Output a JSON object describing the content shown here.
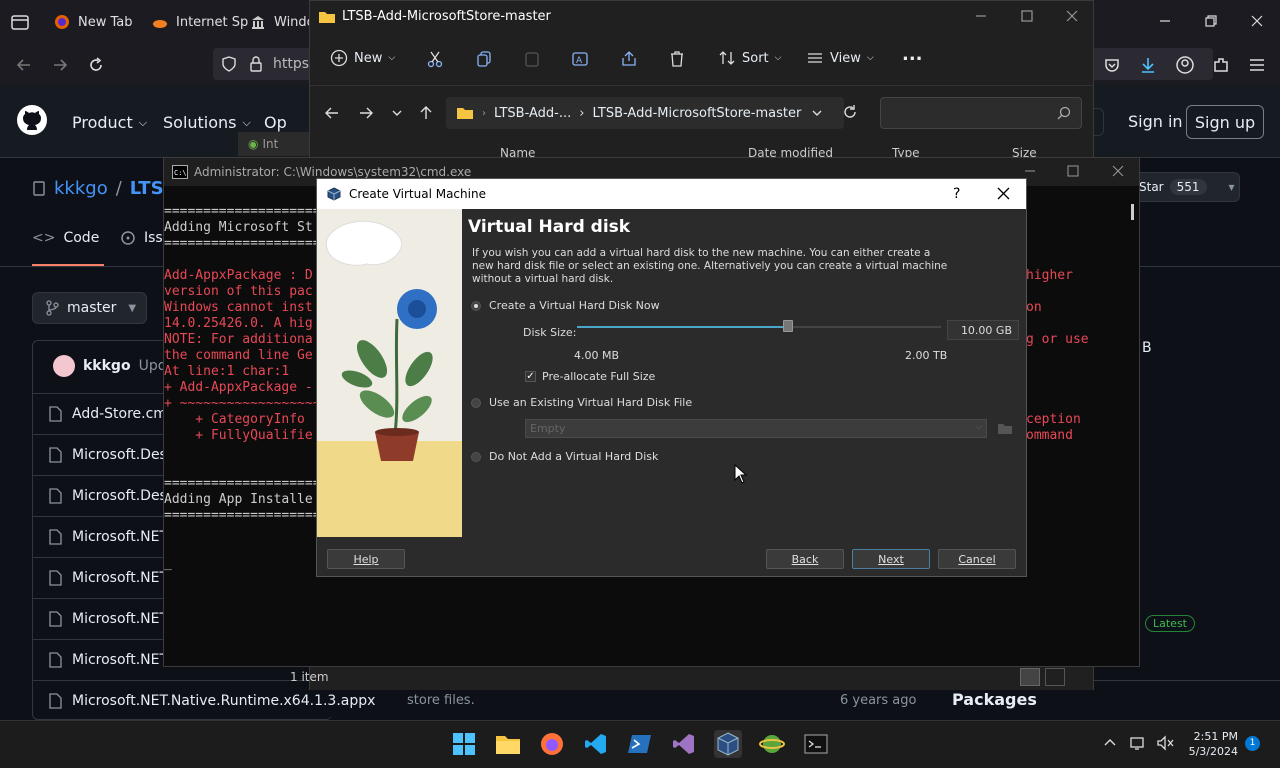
{
  "browser": {
    "tabs": [
      {
        "label": "New Tab"
      },
      {
        "label": "Internet Sp"
      },
      {
        "label": "Window"
      }
    ],
    "url": "https:"
  },
  "github": {
    "nav": [
      "Product",
      "Solutions",
      "Op"
    ],
    "sign_in": "Sign in",
    "sign_up": "Sign up",
    "owner": "kkkgo",
    "repo": "LTSB",
    "tabs": {
      "code": "Code",
      "issues": "Issu"
    },
    "branch": "master",
    "commit_user": "kkkgo",
    "commit_text": "Upda",
    "star_label": "Star",
    "star_count": "551",
    "files": [
      "Add-Store.cmd",
      "Microsoft.Desk",
      "Microsoft.Desk",
      "Microsoft.NET.",
      "Microsoft.NET.",
      "Microsoft.NET.",
      "Microsoft.NET.",
      "Microsoft.NET.Native.Runtime.x64.1.3.appx"
    ],
    "last_row_msg": "store files.",
    "last_row_date": "6 years ago",
    "side_size": "B",
    "latest_badge": "Latest",
    "packages": "Packages",
    "behind_ie_label": "Int"
  },
  "explorer": {
    "title": "LTSB-Add-MicrosoftStore-master",
    "toolbar": {
      "new": "New",
      "sort": "Sort",
      "view": "View",
      "more": "..."
    },
    "breadcrumb": [
      "LTSB-Add-...",
      "LTSB-Add-MicrosoftStore-master"
    ],
    "columns": [
      "Name",
      "Date modified",
      "Type",
      "Size"
    ],
    "status": "1 item"
  },
  "cmd": {
    "title": "Administrator: C:\\Windows\\system32\\cmd.exe",
    "lines_left": [
      {
        "t": "==============================",
        "c": "w"
      },
      {
        "t": "Adding Microsoft St",
        "c": "w"
      },
      {
        "t": "==============================",
        "c": "w"
      },
      {
        "t": "",
        "c": "w"
      },
      {
        "t": "Add-AppxPackage : D",
        "c": "r"
      },
      {
        "t": "version of this pac",
        "c": "r"
      },
      {
        "t": "Windows cannot inst",
        "c": "r"
      },
      {
        "t": "14.0.25426.0. A hig",
        "c": "r"
      },
      {
        "t": "NOTE: For additiona",
        "c": "r"
      },
      {
        "t": "the command line Ge",
        "c": "r"
      },
      {
        "t": "At line:1 char:1",
        "c": "r"
      },
      {
        "t": "+ Add-AppxPackage -",
        "c": "r"
      },
      {
        "t": "+ ~~~~~~~~~~~~~~~~~~",
        "c": "r"
      },
      {
        "t": "    + CategoryInfo",
        "c": "r"
      },
      {
        "t": "    + FullyQualifie",
        "c": "r"
      },
      {
        "t": "",
        "c": "w"
      },
      {
        "t": "",
        "c": "w"
      },
      {
        "t": "==============================",
        "c": "w"
      },
      {
        "t": "Adding App Installe",
        "c": "w"
      },
      {
        "t": "==============================",
        "c": "w"
      },
      {
        "t": "",
        "c": "w"
      },
      {
        "t": "",
        "c": "w"
      },
      {
        "t": "_",
        "c": "w"
      }
    ],
    "lines_right": [
      {
        "t": "",
        "c": "r"
      },
      {
        "t": "",
        "c": "r"
      },
      {
        "t": "",
        "c": "r"
      },
      {
        "t": "",
        "c": "r"
      },
      {
        "t": "higher",
        "c": "r"
      },
      {
        "t": "",
        "c": "r"
      },
      {
        "t": "on",
        "c": "r"
      },
      {
        "t": "",
        "c": "r"
      },
      {
        "t": "g or use",
        "c": "r"
      },
      {
        "t": "",
        "c": "r"
      },
      {
        "t": "",
        "c": "r"
      },
      {
        "t": "",
        "c": "r"
      },
      {
        "t": "",
        "c": "r"
      },
      {
        "t": "ception",
        "c": "r"
      },
      {
        "t": "ommand",
        "c": "r"
      }
    ]
  },
  "vbox": {
    "title": "Create Virtual Machine",
    "help_q": "?",
    "heading": "Virtual Hard disk",
    "description": "If you wish you can add a virtual hard disk to the new machine. You can either create a new hard disk file or select an existing one. Alternatively you can create a virtual machine without a virtual hard disk.",
    "opt_create": "Create a Virtual Hard Disk Now",
    "disk_size_label": "Disk Size:",
    "disk_size_value": "10.00 GB",
    "disk_size_fraction": 0.58,
    "min_label": "4.00 MB",
    "max_label": "2.00 TB",
    "prealloc": "Pre-allocate Full Size",
    "opt_existing": "Use an Existing Virtual Hard Disk File",
    "existing_value": "Empty",
    "opt_none": "Do Not Add a Virtual Hard Disk",
    "buttons": {
      "help": "Help",
      "back": "Back",
      "next": "Next",
      "cancel": "Cancel"
    }
  },
  "taskbar": {
    "time": "2:51 PM",
    "date": "5/3/2024",
    "notif": "1",
    "apps": [
      "start-icon",
      "file-explorer-icon",
      "firefox-icon",
      "vscode-icon",
      "powershell-icon",
      "visual-studio-icon",
      "virtualbox-icon",
      "internet-icon",
      "terminal-icon"
    ]
  },
  "colors": {
    "gh_bg": "#0d1117",
    "gh_link": "#4493f8",
    "cmd_red": "#e74856",
    "accent": "#0078d4"
  }
}
